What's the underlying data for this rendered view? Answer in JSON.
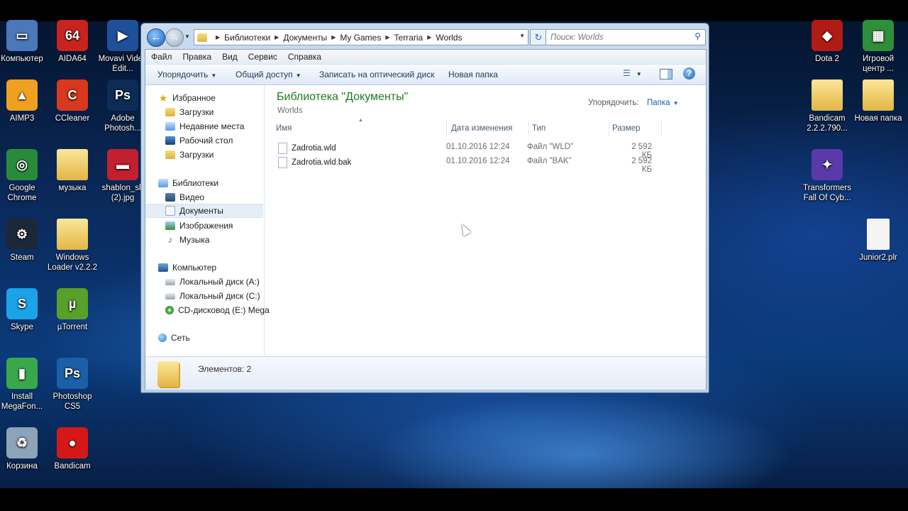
{
  "desktop": {
    "left_icons": [
      {
        "label": "Компьютер",
        "icon": "computer-icon",
        "color": "#4a78b8"
      },
      {
        "label": "AIDA64",
        "icon": "aida64-icon",
        "color": "#c8231e"
      },
      {
        "label": "Movavi Video Edit...",
        "icon": "movavi-icon",
        "color": "#1f4f99"
      },
      {
        "label": "AIMP3",
        "icon": "aimp-icon",
        "color": "#f0a020"
      },
      {
        "label": "CCleaner",
        "icon": "ccleaner-icon",
        "color": "#d8381e"
      },
      {
        "label": "Adobe Photosh...",
        "icon": "photoshop-icon",
        "color": "#0d2b55"
      },
      {
        "label": "Google Chrome",
        "icon": "chrome-icon",
        "color": "#2a8a3c"
      },
      {
        "label": "музыка",
        "icon": "folder-icon",
        "color": "#e8c45a"
      },
      {
        "label": "shablon_sh (2).jpg",
        "icon": "image-file-icon",
        "color": "#c02030"
      },
      {
        "label": "Steam",
        "icon": "steam-icon",
        "color": "#1b2838"
      },
      {
        "label": "Windows Loader v2.2.2",
        "icon": "folder-icon",
        "color": "#e8c45a"
      },
      {
        "label": "Skype",
        "icon": "skype-icon",
        "color": "#1aa3e8"
      },
      {
        "label": "µTorrent",
        "icon": "utorrent-icon",
        "color": "#58a02a"
      },
      {
        "label": "Install MegaFon...",
        "icon": "megafon-icon",
        "color": "#3aa84a"
      },
      {
        "label": "Photoshop CS5",
        "icon": "photoshop-icon",
        "color": "#1b5fa6"
      },
      {
        "label": "Корзина",
        "icon": "recycle-bin-icon",
        "color": "#8da3b8"
      },
      {
        "label": "Bandicam",
        "icon": "bandicam-icon",
        "color": "#d41818"
      }
    ],
    "right_icons": [
      {
        "label": "Dota 2",
        "icon": "dota2-icon",
        "color": "#b01c14"
      },
      {
        "label": "Игровой центр ...",
        "icon": "game-center-icon",
        "color": "#2e8f3a"
      },
      {
        "label": "Bandicam 2.2.2.790...",
        "icon": "folder-icon",
        "color": "#e8c45a"
      },
      {
        "label": "Новая папка",
        "icon": "folder-icon",
        "color": "#e8c45a"
      },
      {
        "label": "Transformers Fall Of Cyb...",
        "icon": "transformers-icon",
        "color": "#5a3aa8"
      },
      {
        "label": "Junior2.plr",
        "icon": "file-icon",
        "color": "#f2f2f2"
      }
    ]
  },
  "explorer": {
    "breadcrumb": [
      "Библиотеки",
      "Документы",
      "My Games",
      "Terraria",
      "Worlds"
    ],
    "search_placeholder": "Поиск: Worlds",
    "menu": [
      "Файл",
      "Правка",
      "Вид",
      "Сервис",
      "Справка"
    ],
    "toolbar": {
      "organize": "Упорядочить",
      "share": "Общий доступ",
      "burn": "Записать на оптический диск",
      "new_folder": "Новая папка"
    },
    "nav": {
      "favorites": "Избранное",
      "fav_items": [
        "Загрузки",
        "Недавние места",
        "Рабочий стол",
        "Загрузки"
      ],
      "libraries": "Библиотеки",
      "lib_items": [
        "Видео",
        "Документы",
        "Изображения",
        "Музыка"
      ],
      "computer": "Компьютер",
      "drives": [
        "Локальный диск (A:)",
        "Локальный диск (C:)",
        "CD-дисковод (E:) Mega"
      ],
      "network": "Сеть"
    },
    "library_title": "Библиотека \"Документы\"",
    "library_subtitle": "Worlds",
    "arrange_label": "Упорядочить:",
    "arrange_value": "Папка",
    "columns": [
      "Имя",
      "Дата изменения",
      "Тип",
      "Размер"
    ],
    "files": [
      {
        "name": "Zadrotia.wld",
        "date": "01.10.2016 12:24",
        "type": "Файл \"WLD\"",
        "size": "2 592 КБ"
      },
      {
        "name": "Zadrotia.wld.bak",
        "date": "01.10.2016 12:24",
        "type": "Файл \"BAK\"",
        "size": "2 592 КБ"
      }
    ],
    "status": "Элементов: 2"
  }
}
